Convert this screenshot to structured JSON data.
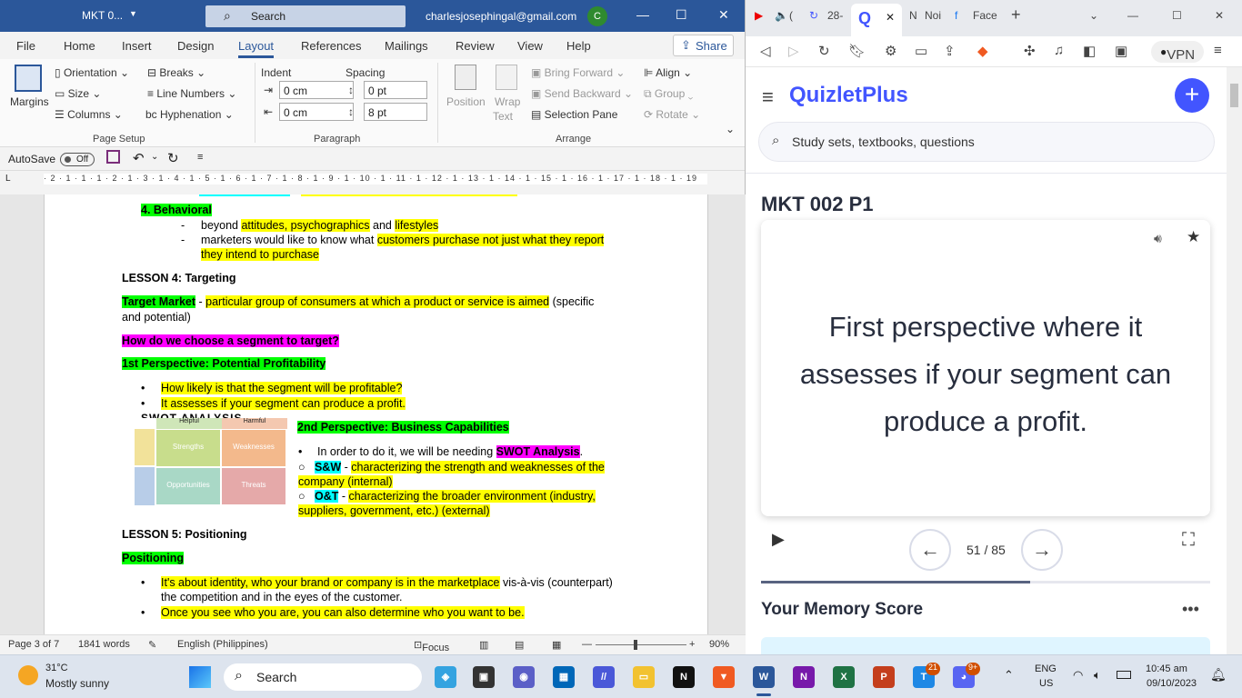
{
  "word": {
    "title": {
      "doc_name": "MKT 0...",
      "search": "Search",
      "email": "charlesjosephingal@gmail.com",
      "avatar": "C"
    },
    "tabs": [
      "File",
      "Home",
      "Insert",
      "Design",
      "Layout",
      "References",
      "Mailings",
      "Review",
      "View",
      "Help"
    ],
    "active_tab": "Layout",
    "share": "Share",
    "ribbon": {
      "margins": "Margins",
      "orientation": "Orientation",
      "size": "Size",
      "columns": "Columns",
      "breaks": "Breaks",
      "line_numbers": "Line Numbers",
      "hyphenation": "Hyphenation",
      "page_setup": "Page Setup",
      "indent": "Indent",
      "spacing": "Spacing",
      "indent_left": "0 cm",
      "indent_right": "0 cm",
      "spacing_before": "0 pt",
      "spacing_after": "8 pt",
      "paragraph": "Paragraph",
      "position": "Position",
      "wrap": "Wrap",
      "text": "Text",
      "bring_forward": "Bring Forward",
      "send_backward": "Send Backward",
      "selection_pane": "Selection Pane",
      "align": "Align",
      "group": "Group",
      "rotate": "Rotate",
      "arrange": "Arrange"
    },
    "qat": {
      "autosave": "AutoSave",
      "toggle": "Off"
    },
    "ruler": "· 2 · 1 · 1 · 1 · 2 · 1 · 3 · 1 · 4 · 1 · 5 · 1 · 6 · 1 · 7 · 1 · 8 · 1 · 9 · 1 · 10 · 1 · 11 · 1 · 12 · 1 · 13 · 1 · 14 · 1 · 15 · 1 · 16 · 1 · 17 · 1 · 18 · 1 · 19",
    "doc": {
      "behavioral": "4.   Behavioral",
      "b1_pre": "beyond ",
      "b1_a": "attitudes, psychographics",
      "b1_mid": " and ",
      "b1_b": "lifestyles",
      "b2_pre": "marketers would like to know what ",
      "b2_hl": "customers purchase not just what they report",
      "b2_cont": "they intend to purchase",
      "lesson4": "LESSON 4: Targeting",
      "tm_term": "Target Market",
      "tm_dash": " - ",
      "tm_def": "particular group of consumers at which a product or service is aimed",
      "tm_rest": " (specific",
      "tm_cont": "and potential)",
      "q_choose": "How do we choose a segment to target?",
      "persp1": "1st Perspective: Potential Profitability",
      "p1_b1": "How likely is that the segment will be profitable?",
      "p1_b2": "It assesses if your segment can produce a profit.",
      "persp2": "2nd Perspective: Business Capabilities",
      "p2_b1_pre": "In order to do it, we will be needing ",
      "p2_b1_hl": "SWOT Analysis",
      "p2_b1_post": ".",
      "sw_term": "S&W",
      "sw_def": "characterizing the strength and weaknesses of the",
      "sw_cont": "company (internal)",
      "ot_term": "O&T",
      "ot_def": "characterizing the broader environment (industry,",
      "ot_cont": "suppliers, government, etc.) (external)",
      "swot_title": "SWOT ANALYSIS",
      "swot_helpful": "Helpful",
      "swot_harmful": "Harmful",
      "swot_s": "Strengths",
      "swot_w": "Weaknesses",
      "swot_o": "Opportunities",
      "swot_t": "Threats",
      "lesson5": "LESSON 5: Positioning",
      "positioning": "Positioning",
      "pos_b1_hl": "It's about identity, who your brand or company is in the marketplace",
      "pos_b1_rest": " vis-à-vis (counterpart)",
      "pos_b1_cont": "the competition and in the eyes of the customer.",
      "pos_b2": "Once you see who you are, you can also determine who you want to be."
    },
    "status": {
      "page": "Page 3 of 7",
      "words": "1841 words",
      "lang": "English (Philippines)",
      "focus": "Focus",
      "zoom": "90%"
    }
  },
  "browser": {
    "tabs": [
      "(",
      "28-",
      "Noi",
      "Face"
    ],
    "vpn": "VPN",
    "logo": "QuizletPlus",
    "search_placeholder": "Study sets, textbooks, questions",
    "set_title": "MKT 002 P1",
    "card_text": "First perspective where it assesses if your segment can produce a profit.",
    "counter": "51 / 85",
    "progress": 0.6,
    "memory_title": "Your Memory Score"
  },
  "taskbar": {
    "temp": "31°C",
    "weather": "Mostly sunny",
    "search": "Search",
    "lang1": "ENG",
    "lang2": "US",
    "time": "10:45 am",
    "date": "09/10/2023",
    "badge_teams": "21",
    "badge_discord": "9+"
  },
  "colors": {
    "word_blue": "#2b579a",
    "quizlet_blue": "#4255ff",
    "highlight_yellow": "#ffff00",
    "highlight_green": "#00ff00",
    "highlight_magenta": "#ff00ff",
    "highlight_cyan": "#00ffff"
  }
}
